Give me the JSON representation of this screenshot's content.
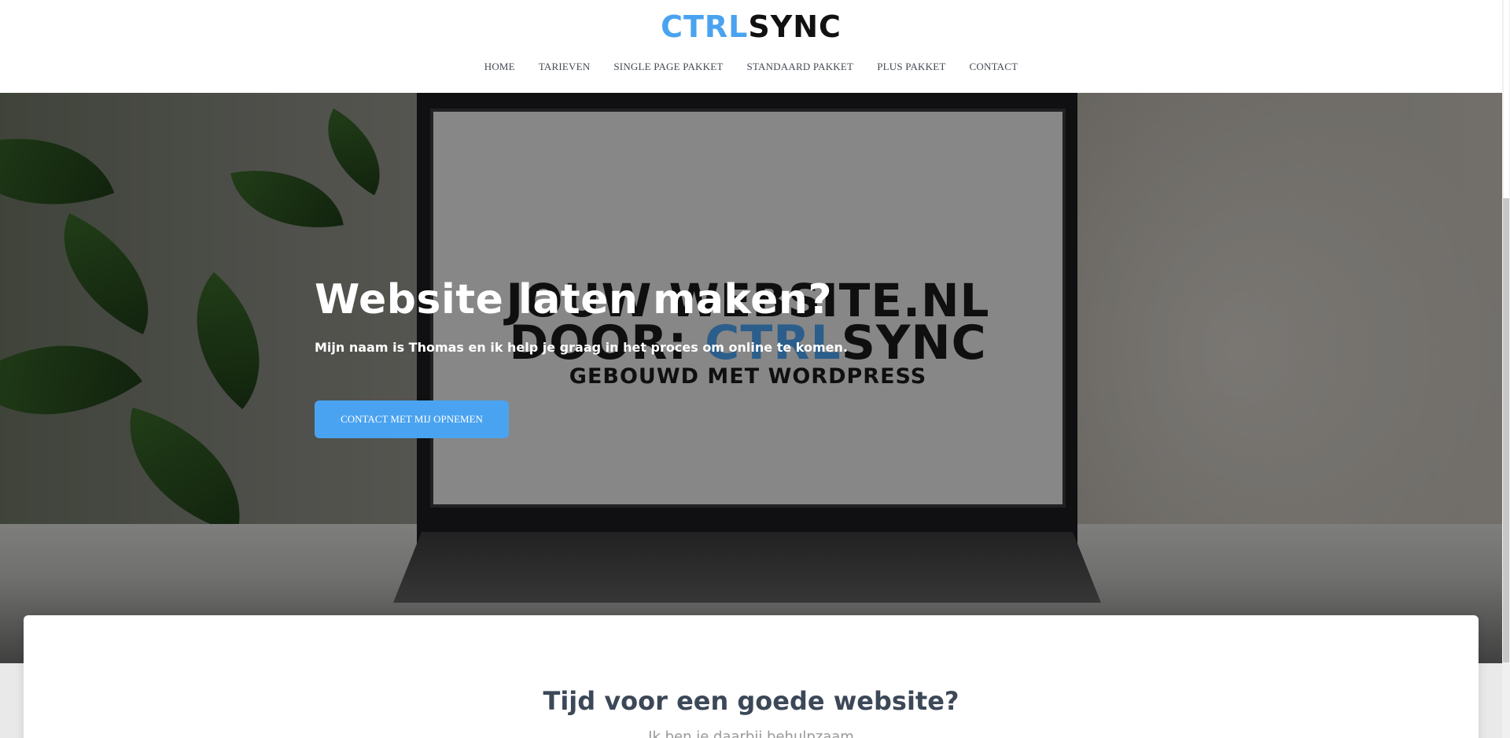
{
  "header": {
    "logo": {
      "part1": "CTRL",
      "part2": "SYNC"
    },
    "nav": [
      {
        "label": "HOME"
      },
      {
        "label": "TARIEVEN"
      },
      {
        "label": "SINGLE PAGE PAKKET"
      },
      {
        "label": "STANDAARD PAKKET"
      },
      {
        "label": "PLUS PAKKET"
      },
      {
        "label": "CONTACT"
      }
    ]
  },
  "hero": {
    "title": "Website laten maken?",
    "subtitle": "Mijn naam is Thomas en ik help je graag in het proces om online te komen.",
    "button_label": "CONTACT MET MIJ OPNEMEN",
    "screen": {
      "line1": "JOUW WEBSITE.NL",
      "line2_prefix": "DOOR: ",
      "line2_blue": "CTRL",
      "line2_dark": "SYNC",
      "line3": "GEBOUWD MET WORDPRESS"
    }
  },
  "section": {
    "title": "Tijd voor een goede website?",
    "subtitle": "Ik ben je daarbij behulpzaam"
  },
  "colors": {
    "accent": "#4aa3f0",
    "heading": "#3c4858",
    "logo_dark": "#111111"
  }
}
